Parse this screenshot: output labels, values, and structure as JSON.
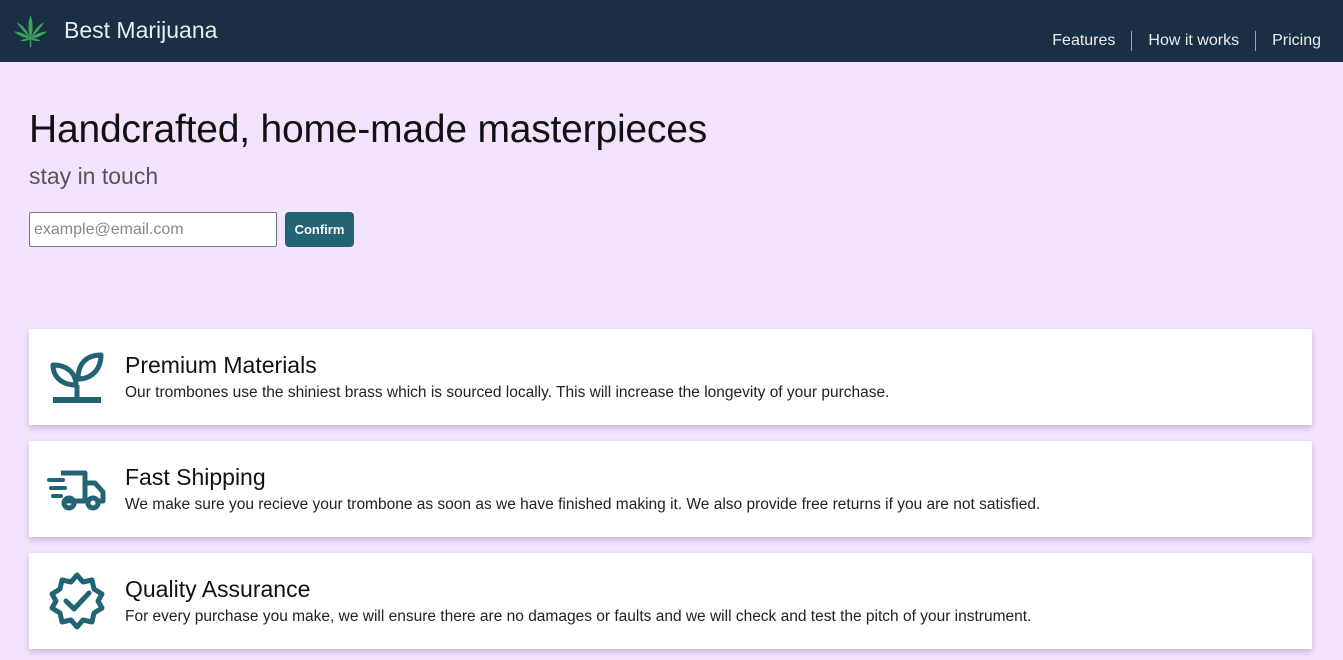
{
  "header": {
    "brand_title": "Best Marijuana",
    "logo_icon": "cannabis-leaf-icon",
    "nav": [
      {
        "label": "Features"
      },
      {
        "label": "How it works"
      },
      {
        "label": "Pricing"
      }
    ]
  },
  "hero": {
    "title": "Handcrafted, home-made masterpieces",
    "subtitle": "stay in touch",
    "email_placeholder": "example@email.com",
    "email_value": "",
    "confirm_label": "Confirm"
  },
  "features": [
    {
      "icon": "seedling-icon",
      "title": "Premium Materials",
      "text": "Our trombones use the shiniest brass which is sourced locally. This will increase the longevity of your purchase."
    },
    {
      "icon": "truck-icon",
      "title": "Fast Shipping",
      "text": "We make sure you recieve your trombone as soon as we have finished making it. We also provide free returns if you are not satisfied."
    },
    {
      "icon": "check-badge-icon",
      "title": "Quality Assurance",
      "text": "For every purchase you make, we will ensure there are no damages or faults and we will check and test the pitch of your instrument."
    }
  ],
  "colors": {
    "navbar": "#1a2e44",
    "background": "#f3e3ff",
    "accent": "#226473",
    "logo_green": "#3aa55a"
  }
}
